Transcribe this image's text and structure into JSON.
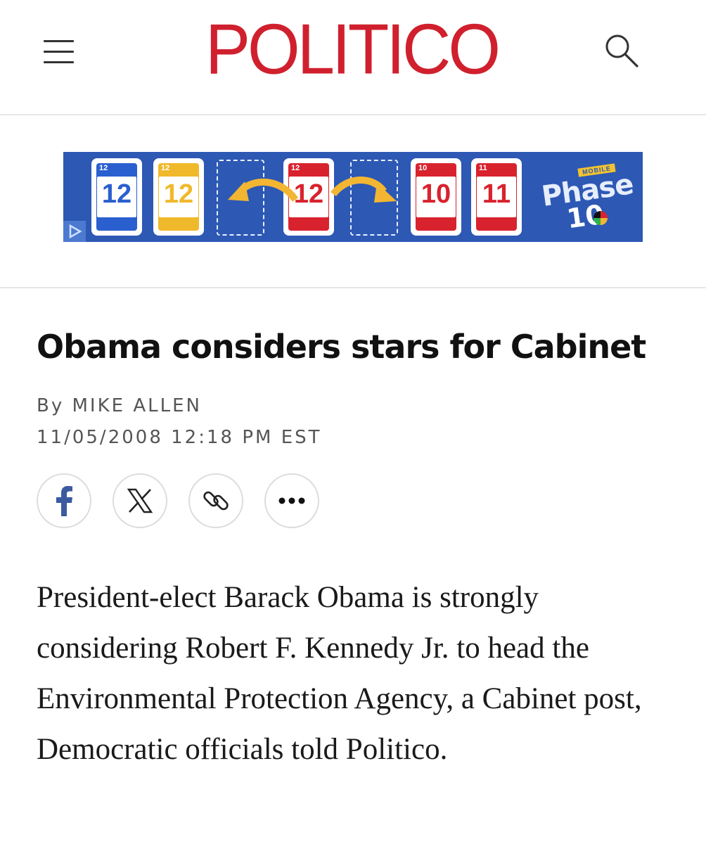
{
  "header": {
    "logo_text": "POLITICO",
    "logo_color": "#d0202e",
    "menu_icon": "hamburger-menu-icon",
    "search_icon": "search-icon"
  },
  "ad": {
    "cards": [
      "12",
      "12",
      "12",
      "10",
      "11"
    ],
    "brand_top": "MOBILE",
    "brand_name": "Phase",
    "brand_number": "10",
    "colors": {
      "background": "#2d58b4",
      "blue": "#2a5fcf",
      "yellow": "#f0b92b",
      "red": "#d8232e",
      "arrow": "#f2b632"
    }
  },
  "article": {
    "headline": "Obama considers stars for Cabinet",
    "byline": "By MIKE ALLEN",
    "timestamp": "11/05/2008 12:18 PM EST",
    "share_icons": [
      "facebook-icon",
      "x-icon",
      "link-icon",
      "more-icon"
    ],
    "body": "President-elect Barack Obama is strongly considering Robert F. Kennedy Jr. to head the Environmental Protection Agency, a Cabinet post, Democratic officials told Politico."
  }
}
